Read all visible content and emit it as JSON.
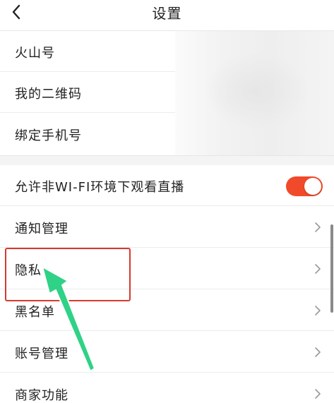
{
  "header": {
    "title": "设置",
    "back_icon": "chevron-left-icon"
  },
  "account_section": {
    "items": [
      {
        "label": "火山号"
      },
      {
        "label": "我的二维码"
      },
      {
        "label": "绑定手机号"
      }
    ]
  },
  "settings": {
    "wifi_toggle": {
      "label": "允许非WI-FI环境下观看直播",
      "enabled": true
    },
    "items": [
      {
        "label": "通知管理",
        "icon": "chevron-right-icon"
      },
      {
        "label": "隐私",
        "icon": "chevron-right-icon"
      },
      {
        "label": "黑名单",
        "icon": "chevron-right-icon"
      },
      {
        "label": "账号管理",
        "icon": "chevron-right-icon"
      },
      {
        "label": "商家功能",
        "icon": "chevron-right-icon"
      }
    ]
  },
  "colors": {
    "toggle_on": "#f04a2a",
    "annotation_box": "#d63a2e",
    "annotation_arrow": "#2fd286"
  }
}
